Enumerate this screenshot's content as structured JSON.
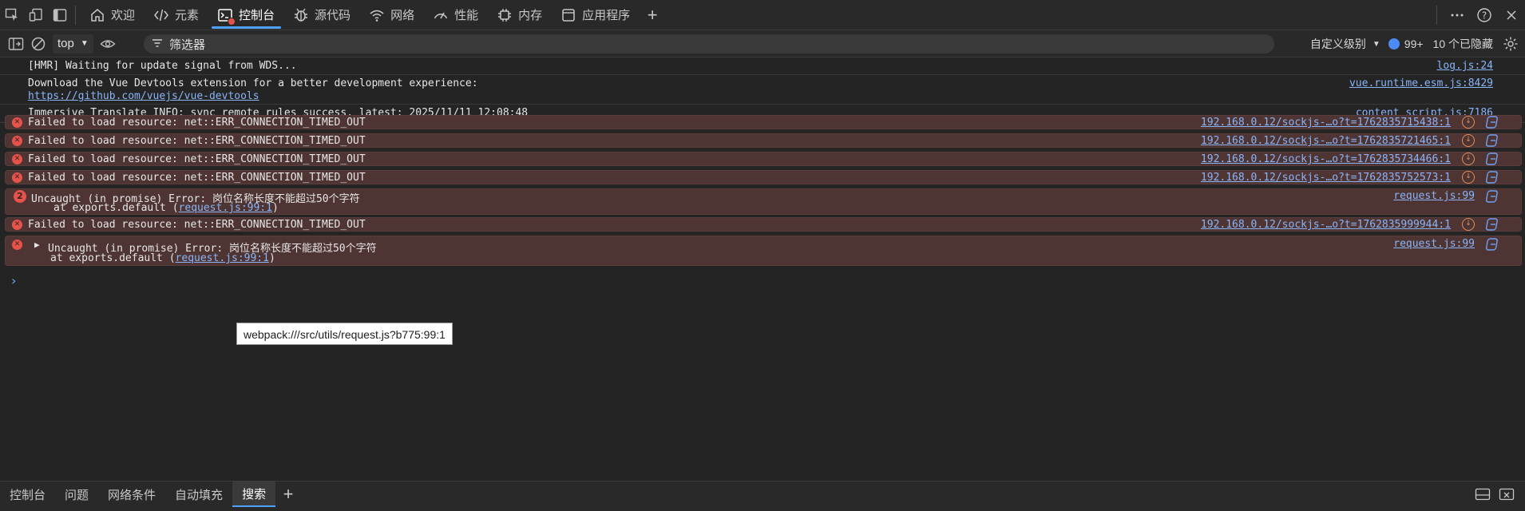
{
  "top_tabs": [
    {
      "label": "欢迎",
      "icon": "home-icon"
    },
    {
      "label": "元素",
      "icon": "code-icon"
    },
    {
      "label": "控制台",
      "icon": "console-icon",
      "active": true
    },
    {
      "label": "源代码",
      "icon": "bug-icon"
    },
    {
      "label": "网络",
      "icon": "wifi-icon"
    },
    {
      "label": "性能",
      "icon": "gauge-icon"
    },
    {
      "label": "内存",
      "icon": "chip-icon"
    },
    {
      "label": "应用程序",
      "icon": "app-icon"
    }
  ],
  "toolbar": {
    "context": "top",
    "filter_placeholder": "筛选器",
    "levels": "自定义级别",
    "issues_count": "99+",
    "hidden": "10 个已隐藏"
  },
  "messages": [
    {
      "type": "log",
      "text": "[HMR] Waiting for update signal from WDS...",
      "source": "log.js:24"
    },
    {
      "type": "log",
      "text": "Download the Vue Devtools extension for a better development experience:",
      "link": "https://github.com/vuejs/vue-devtools",
      "source": "vue.runtime.esm.js:8429"
    },
    {
      "type": "log",
      "text": "Immersive Translate INFO: sync remote rules success, latest: 2025/11/11 12:08:48",
      "source": "content_script.js:7186"
    },
    {
      "type": "error",
      "text": "Failed to load resource: net::ERR_CONNECTION_TIMED_OUT",
      "source": "192.168.0.12/sockjs-…o?t=1762835715438:1"
    },
    {
      "type": "error",
      "text": "Failed to load resource: net::ERR_CONNECTION_TIMED_OUT",
      "source": "192.168.0.12/sockjs-…o?t=1762835721465:1"
    },
    {
      "type": "error",
      "text": "Failed to load resource: net::ERR_CONNECTION_TIMED_OUT",
      "source": "192.168.0.12/sockjs-…o?t=1762835734466:1"
    },
    {
      "type": "error",
      "text": "Failed to load resource: net::ERR_CONNECTION_TIMED_OUT",
      "source": "192.168.0.12/sockjs-…o?t=1762835752573:1"
    },
    {
      "type": "error",
      "count": "2",
      "text": "Uncaught (in promise) Error: 岗位名称长度不能超过50个字符",
      "stack_prefix": "at exports.default (",
      "stack_link": "request.js:99:1",
      "stack_suffix": ")",
      "source": "request.js:99"
    },
    {
      "type": "error",
      "text": "Failed to load resource: net::ERR_CONNECTION_TIMED_OUT",
      "source": "192.168.0.12/sockjs-…o?t=1762835999944:1"
    },
    {
      "type": "error",
      "text": "Uncaught (in promise) Error: 岗位名称长度不能超过50个字符",
      "stack_prefix": "at exports.default (",
      "stack_link": "request.js:99:1",
      "stack_suffix": ")",
      "source": "request.js:99"
    }
  ],
  "tooltip": "webpack:///src/utils/request.js?b775:99:1",
  "drawer_tabs": [
    "控制台",
    "问题",
    "网络条件",
    "自动填充",
    "搜索"
  ],
  "drawer_active": "搜索"
}
